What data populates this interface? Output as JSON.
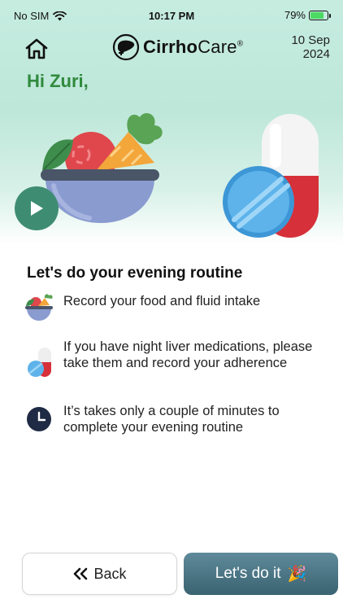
{
  "status_bar": {
    "carrier": "No SIM",
    "time": "10:17 PM",
    "battery": "79%",
    "battery_level": 0.79
  },
  "header": {
    "home_icon": "home-icon",
    "logo_bold": "Cirrho",
    "logo_regular": "Care",
    "logo_reg": "®",
    "date_line1": "10 Sep",
    "date_line2": "2024"
  },
  "greeting": "Hi Zuri,",
  "routine": {
    "title": "Let's do your evening routine",
    "items": [
      {
        "icon": "food-bowl-icon",
        "text": "Record your food and fluid intake"
      },
      {
        "icon": "pill-icon",
        "text": "If you have night liver medications, please take them and record your adherence"
      },
      {
        "icon": "clock-icon",
        "text": "It’s takes only a couple of minutes to complete your evening routine"
      }
    ]
  },
  "buttons": {
    "back_label": "Back",
    "go_label": "Let's do it",
    "go_emoji": "🎉"
  },
  "colors": {
    "greeting": "#2f8a3c",
    "play_button": "#3e8d72",
    "primary_button": "#3b6372",
    "hero_bg": "#c6ece0"
  }
}
